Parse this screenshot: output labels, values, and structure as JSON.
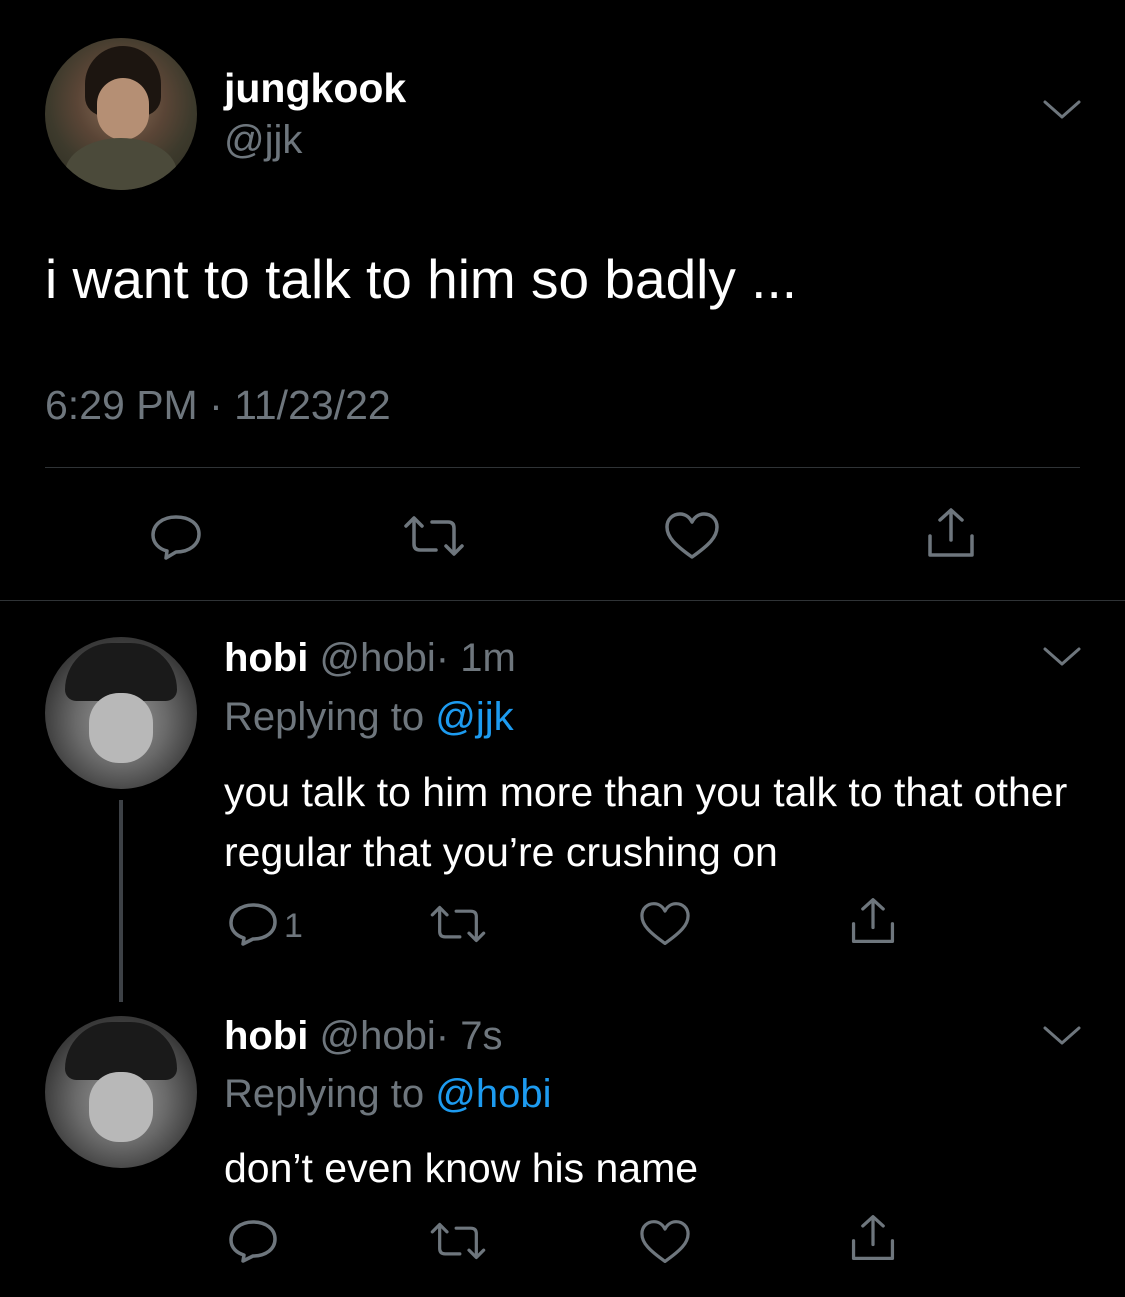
{
  "main_tweet": {
    "display_name": "jungkook",
    "handle": "@jjk",
    "text": "i want to talk to him so badly ...",
    "timestamp": "6:29 PM · 11/23/22"
  },
  "replies": [
    {
      "display_name": "hobi",
      "handle": "@hobi",
      "time": "· 1m",
      "replying_prefix": "Replying to",
      "replying_to": "@jjk",
      "text": "you talk to him more than you talk to that other regular that you’re crushing on",
      "reply_count": "1"
    },
    {
      "display_name": "hobi",
      "handle": "@hobi",
      "time": "· 7s",
      "replying_prefix": "Replying to",
      "replying_to": "@hobi",
      "text": "don’t even know his name",
      "reply_count": ""
    }
  ],
  "icons": [
    "chevron-down-icon",
    "reply-icon",
    "retweet-icon",
    "like-icon",
    "share-icon"
  ],
  "colors": {
    "background": "#000000",
    "text": "#ffffff",
    "muted": "#6e767d",
    "link": "#1d9bf0",
    "divider": "#2f3336"
  }
}
